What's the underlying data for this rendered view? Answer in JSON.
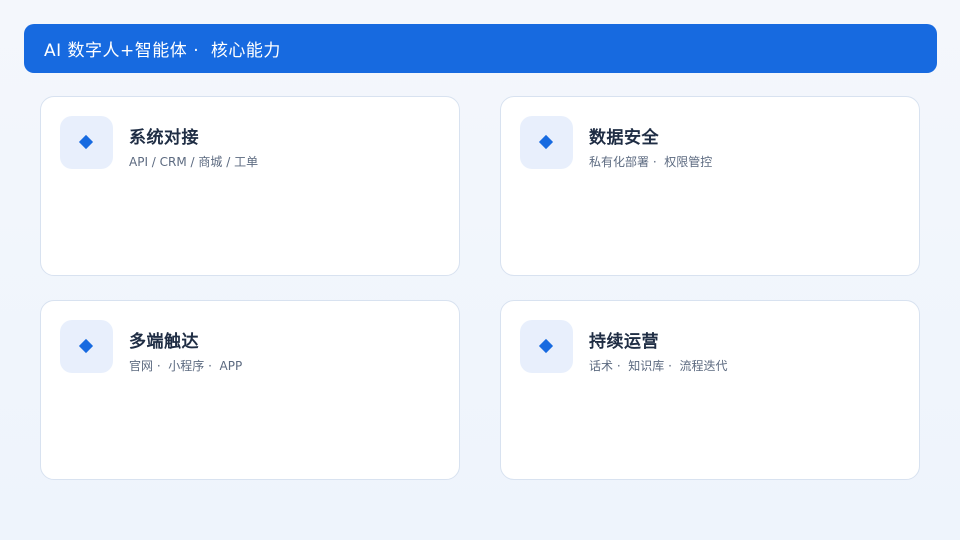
{
  "header": {
    "title": "AI 数字人+智能体 ·  核心能力"
  },
  "cards": [
    {
      "icon": "diamond-icon",
      "title": "系统对接",
      "subtitle": "API / CRM / 商城 / 工单"
    },
    {
      "icon": "diamond-icon",
      "title": "数据安全",
      "subtitle": "私有化部署 ·  权限管控"
    },
    {
      "icon": "diamond-icon",
      "title": "多端触达",
      "subtitle": "官网 ·  小程序 ·  APP"
    },
    {
      "icon": "diamond-icon",
      "title": "持续运营",
      "subtitle": "话术 ·  知识库 ·  流程迭代"
    }
  ],
  "colors": {
    "accent": "#176ae0",
    "icon_bg": "#e8effc",
    "card_border": "#d8e2f0",
    "title_text": "#1f2d44",
    "subtitle_text": "#5c6a80"
  }
}
